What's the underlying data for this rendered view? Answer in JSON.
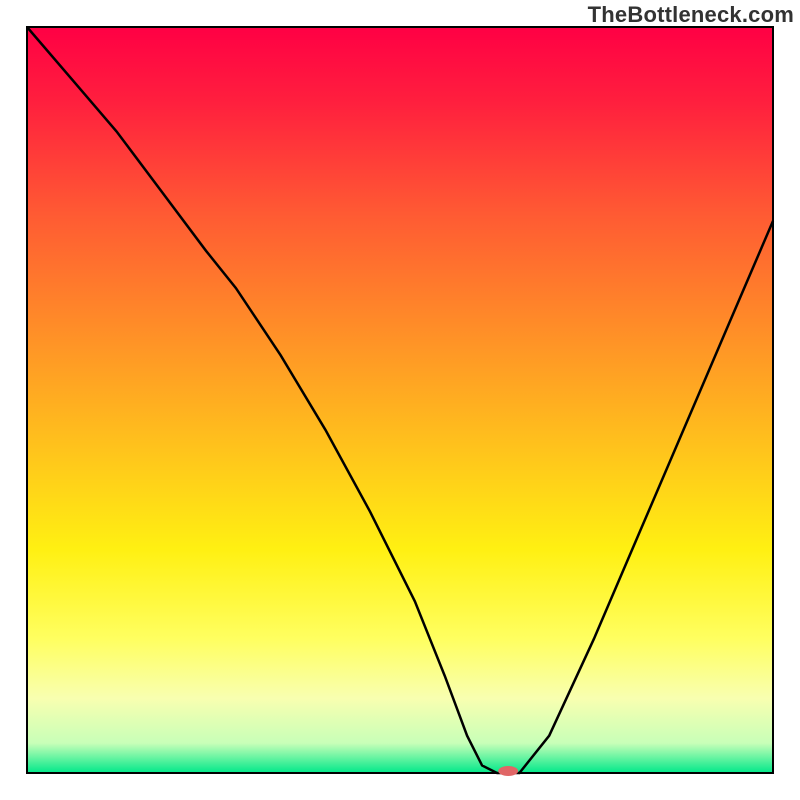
{
  "watermark": "TheBottleneck.com",
  "chart_data": {
    "type": "line",
    "title": "",
    "xlabel": "",
    "ylabel": "",
    "xlim": [
      0,
      100
    ],
    "ylim": [
      0,
      100
    ],
    "grid": false,
    "legend": false,
    "description": "Black bottleneck curve over red-yellow-green vertical gradient background with a small red marker at the curve minimum.",
    "gradient_stops": [
      {
        "offset": 0.0,
        "color": "#ff0044"
      },
      {
        "offset": 0.1,
        "color": "#ff1f3e"
      },
      {
        "offset": 0.25,
        "color": "#ff5a33"
      },
      {
        "offset": 0.4,
        "color": "#ff8c28"
      },
      {
        "offset": 0.55,
        "color": "#ffbe1d"
      },
      {
        "offset": 0.7,
        "color": "#fff012"
      },
      {
        "offset": 0.82,
        "color": "#ffff60"
      },
      {
        "offset": 0.9,
        "color": "#f8ffb0"
      },
      {
        "offset": 0.96,
        "color": "#c8ffb8"
      },
      {
        "offset": 1.0,
        "color": "#00e88a"
      }
    ],
    "series": [
      {
        "name": "bottleneck-curve",
        "color": "#000000",
        "x": [
          0,
          6,
          12,
          18,
          24,
          28,
          34,
          40,
          46,
          52,
          56,
          59,
          61,
          63,
          66,
          70,
          76,
          82,
          88,
          94,
          100
        ],
        "values": [
          100,
          93,
          86,
          78,
          70,
          65,
          56,
          46,
          35,
          23,
          13,
          5,
          1,
          0,
          0,
          5,
          18,
          32,
          46,
          60,
          74
        ]
      }
    ],
    "min_marker": {
      "x": 64.5,
      "y": 0,
      "color": "#e06666",
      "rx": 10,
      "ry": 5
    },
    "frame": {
      "stroke": "#000000",
      "width": 2
    }
  }
}
